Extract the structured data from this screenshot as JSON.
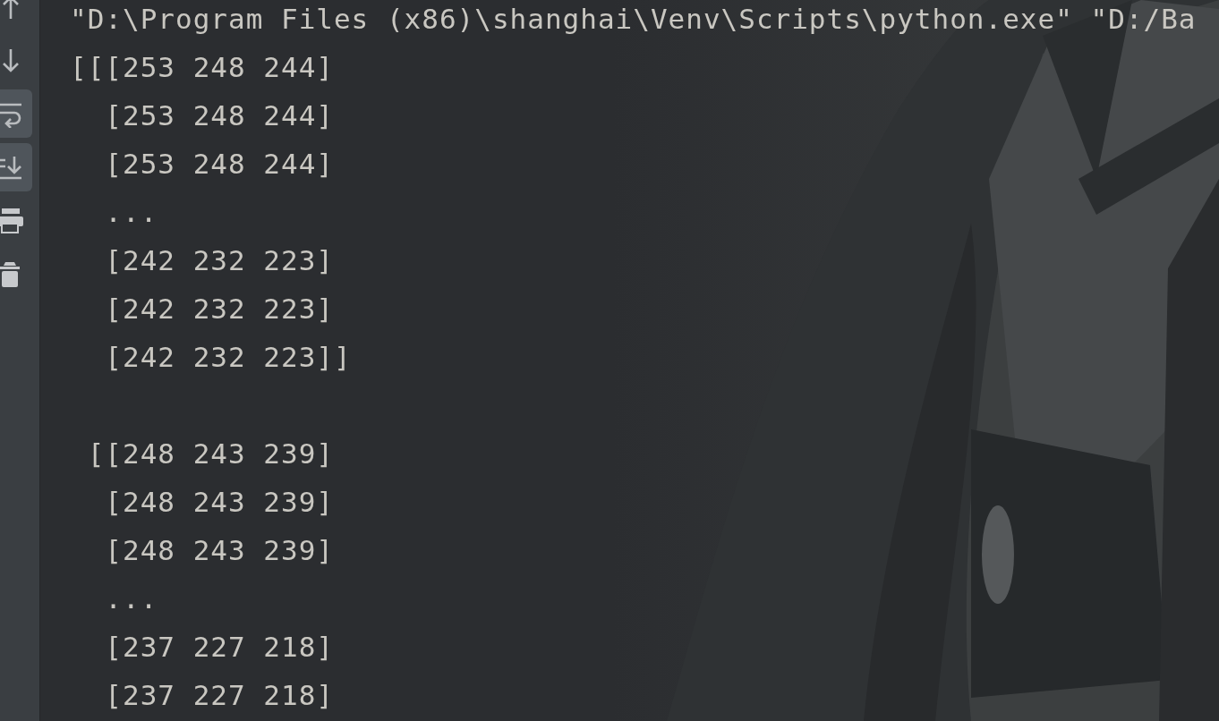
{
  "toolbar": [
    {
      "selected": false
    },
    {
      "selected": false
    },
    {
      "selected": true
    },
    {
      "selected": true
    },
    {
      "selected": false
    },
    {
      "selected": false
    }
  ],
  "console": {
    "command": "\"D:\\Program Files (x86)\\shanghai\\Venv\\Scripts\\python.exe\" \"D:/Ba",
    "blocks": [
      [
        "[[[253 248 244]",
        "  [253 248 244]",
        "  [253 248 244]",
        "  ...",
        "  [242 232 223]",
        "  [242 232 223]",
        "  [242 232 223]]"
      ],
      [
        " [[248 243 239]",
        "  [248 243 239]",
        "  [248 243 239]",
        "  ...",
        "  [237 227 218]",
        "  [237 227 218]"
      ]
    ]
  }
}
